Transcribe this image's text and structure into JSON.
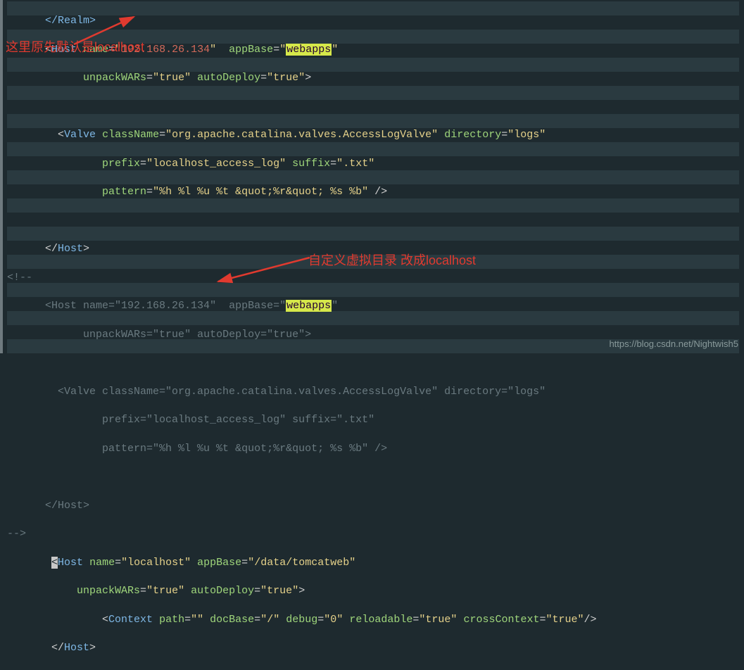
{
  "code": {
    "l1_realm": "</Realm>",
    "l2_host": "Host",
    "l2_name_attr": "name",
    "l2_name_val": "192.168.26.134",
    "l2_appbase_attr": "appBase",
    "l2_appbase_val": "webapps",
    "l3_unpack_attr": "unpackWARs",
    "l3_unpack_val": "true",
    "l3_auto_attr": "autoDeploy",
    "l3_auto_val": "true",
    "l5_valve": "Valve",
    "l5_class_attr": "className",
    "l5_class_val": "org.apache.catalina.valves.AccessLogValve",
    "l5_dir_attr": "directory",
    "l5_dir_val": "logs",
    "l6_prefix_attr": "prefix",
    "l6_prefix_val": "localhost_access_log",
    "l6_suffix_attr": "suffix",
    "l6_suffix_val": ".txt",
    "l7_pattern_attr": "pattern",
    "l7_pattern_val": "%h %l %u %t &quot;%r&quot; %s %b",
    "l9_host_close": "Host",
    "l10_cstart": "<!--",
    "l11_name_val": "192.168.26.134",
    "l11_appbase_val": "webapps",
    "l18_cend": "-->",
    "l19_host": "Host",
    "l19_name_val": "localhost",
    "l19_appbase_val": "/data/tomcatweb",
    "l21_context": "Context",
    "l21_path_attr": "path",
    "l21_path_val": "",
    "l21_doc_attr": "docBase",
    "l21_doc_val": "/",
    "l21_debug_attr": "debug",
    "l21_debug_val": "0",
    "l21_reload_attr": "reloadable",
    "l21_reload_val": "true",
    "l21_cross_attr": "crossContext",
    "l21_cross_val": "true"
  },
  "annotations": {
    "top": "这里原先默认是localhost",
    "mid": "自定义虚拟目录 改成localhost"
  },
  "watermark": "https://blog.csdn.net/Nightwish5"
}
